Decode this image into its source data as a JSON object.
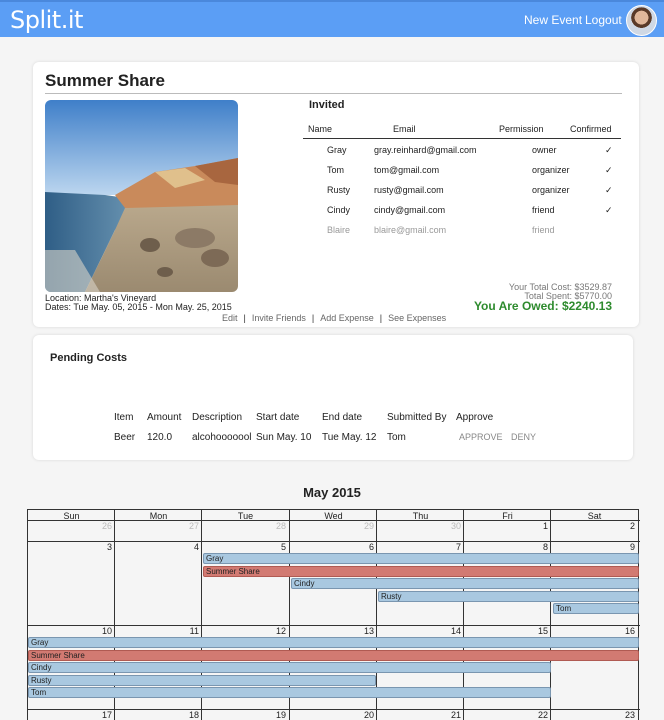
{
  "nav": {
    "brand": "Split.it",
    "new_event": "New Event",
    "logout": "Logout"
  },
  "trip": {
    "title": "Summer Share",
    "location": "Location: Martha's Vineyard",
    "dates": "Dates: Tue May. 05, 2015 - Mon May. 25, 2015",
    "total_cost": "Your Total Cost: $3529.87",
    "total_spent": "Total Spent: $5770.00",
    "owed": "You Are Owed: $2240.13"
  },
  "invited": {
    "heading": "Invited",
    "headers": {
      "name": "Name",
      "email": "Email",
      "permission": "Permission",
      "confirmed": "Confirmed"
    },
    "rows": [
      {
        "name": "Gray",
        "email": "gray.reinhard@gmail.com",
        "permission": "owner",
        "confirmed": "✓"
      },
      {
        "name": "Tom",
        "email": "tom@gmail.com",
        "permission": "organizer",
        "confirmed": "✓"
      },
      {
        "name": "Rusty",
        "email": "rusty@gmail.com",
        "permission": "organizer",
        "confirmed": "✓"
      },
      {
        "name": "Cindy",
        "email": "cindy@gmail.com",
        "permission": "friend",
        "confirmed": "✓"
      },
      {
        "name": "Blaire",
        "email": "blaire@gmail.com",
        "permission": "friend",
        "confirmed": ""
      }
    ]
  },
  "actions": {
    "edit": "Edit",
    "invite": "Invite Friends",
    "add_expense": "Add Expense",
    "see_expenses": "See Expenses",
    "separator": "|"
  },
  "pending": {
    "title": "Pending Costs",
    "headers": {
      "item": "Item",
      "amount": "Amount",
      "description": "Description",
      "start": "Start date",
      "end": "End date",
      "submitted": "Submitted By",
      "approve": "Approve"
    },
    "row": {
      "item": "Beer",
      "amount": "120.0",
      "description": "alcohooooool",
      "start": "Sun May. 10",
      "end": "Tue May. 12",
      "submitted": "Tom",
      "approve": "APPROVE",
      "deny": "DENY"
    }
  },
  "calendar": {
    "title": "May 2015",
    "daynames": [
      "Sun",
      "Mon",
      "Tue",
      "Wed",
      "Thu",
      "Fri",
      "Sat"
    ],
    "weeks": [
      [
        "26",
        "27",
        "28",
        "29",
        "30",
        "1",
        "2"
      ],
      [
        "3",
        "4",
        "5",
        "6",
        "7",
        "8",
        "9"
      ],
      [
        "10",
        "11",
        "12",
        "13",
        "14",
        "15",
        "16"
      ],
      [
        "17",
        "18",
        "19",
        "20",
        "21",
        "22",
        "23"
      ]
    ],
    "week2_events": [
      "Gray",
      "Summer Share",
      "Cindy",
      "Rusty",
      "Tom"
    ],
    "week3_events": [
      "Gray",
      "Summer Share",
      "Cindy",
      "Rusty",
      "Tom"
    ]
  },
  "colors": {
    "nav": "#5b9ef5",
    "owed": "#2e8b2e",
    "event": "#a9c8e0",
    "trip_event": "#d27a72"
  }
}
